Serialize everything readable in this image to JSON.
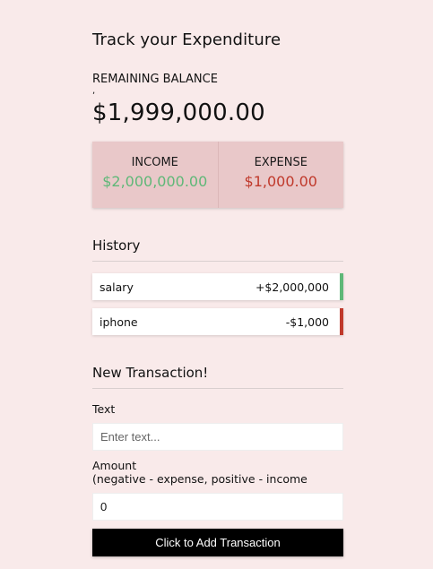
{
  "header": {
    "title": "Track your Expenditure"
  },
  "balance": {
    "label": "REMAINING BALANCE",
    "tick": ",",
    "value": "$1,999,000.00"
  },
  "summary": {
    "income_label": "INCOME",
    "income_value": "$2,000,000.00",
    "expense_label": "EXPENSE",
    "expense_value": "$1,000.00",
    "colors": {
      "income": "#5fb878",
      "expense": "#c0392b"
    }
  },
  "history": {
    "heading": "History",
    "items": [
      {
        "text": "salary",
        "amount": "+$2,000,000",
        "type": "income"
      },
      {
        "text": "iphone",
        "amount": "-$1,000",
        "type": "expense"
      }
    ]
  },
  "form": {
    "heading": "New Transaction!",
    "text_label": "Text",
    "text_placeholder": "Enter text...",
    "text_value": "",
    "amount_label": "Amount",
    "amount_hint": "(negative - expense, positive - income",
    "amount_value": "0",
    "submit_label": "Click to Add Transaction"
  }
}
